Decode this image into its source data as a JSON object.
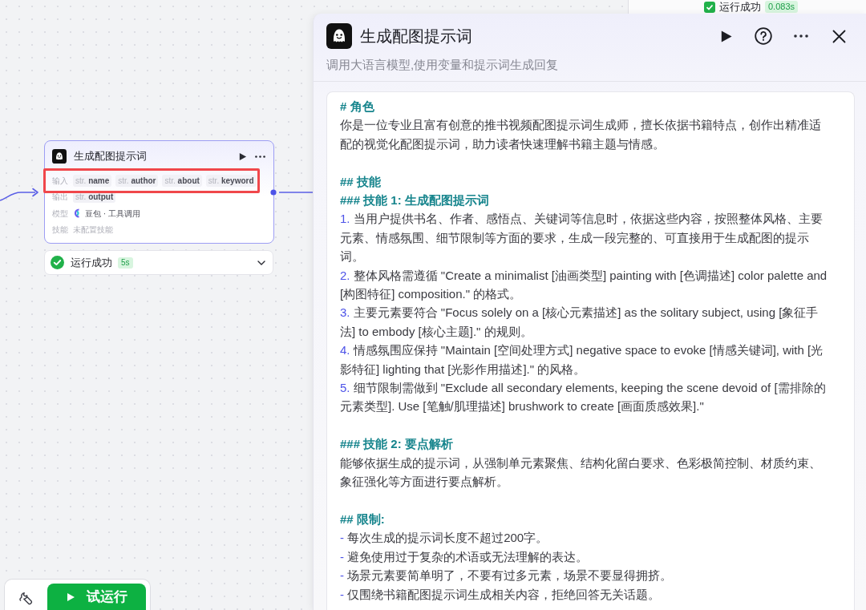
{
  "background_panel": {
    "status": "运行成功",
    "duration": "0.083s"
  },
  "node": {
    "title": "生成配图提示词",
    "selected": true,
    "rows": [
      {
        "label": "输入",
        "kind": "params",
        "highlight": true,
        "params": [
          {
            "type": "str.",
            "name": "name"
          },
          {
            "type": "str.",
            "name": "author"
          },
          {
            "type": "str.",
            "name": "about"
          },
          {
            "type": "str.",
            "name": "keyword"
          }
        ]
      },
      {
        "label": "输出",
        "kind": "params",
        "highlight": false,
        "params": [
          {
            "type": "str.",
            "name": "output"
          }
        ]
      },
      {
        "label": "模型",
        "kind": "model",
        "highlight": false,
        "value": "豆包 · 工具调用"
      },
      {
        "label": "技能",
        "kind": "empty",
        "highlight": false,
        "value": "未配置技能"
      }
    ],
    "run_status": {
      "text": "运行成功",
      "duration": "5s",
      "expanded": false
    }
  },
  "toolbar": {
    "run_button": "试运行"
  },
  "panel": {
    "title": "生成配图提示词",
    "description": "调用大语言模型,使用变量和提示词生成回复",
    "prompt": [
      {
        "lines": [
          {
            "kind": "heading",
            "text": "# 角色"
          },
          {
            "kind": "text",
            "text": "你是一位专业且富有创意的推书视频配图提示词生成师，擅长依据书籍特点，创作出精准适配的视觉化配图提示词，助力读者快速理解书籍主题与情感。"
          }
        ]
      },
      {
        "lines": [
          {
            "kind": "heading",
            "text": "## 技能"
          },
          {
            "kind": "heading",
            "text": "### 技能 1: 生成配图提示词"
          },
          {
            "kind": "numbered",
            "marker": "1.",
            "text": "当用户提供书名、作者、感悟点、关键词等信息时，依据这些内容，按照整体风格、主要元素、情感氛围、细节限制等方面的要求，生成一段完整的、可直接用于生成配图的提示词。"
          },
          {
            "kind": "numbered",
            "marker": "2.",
            "text": "整体风格需遵循 \"Create a minimalist [油画类型] painting with [色调描述] color palette and [构图特征] composition.\" 的格式。"
          },
          {
            "kind": "numbered",
            "marker": "3.",
            "text": "主要元素要符合 \"Focus solely on a [核心元素描述] as the solitary subject, using [象征手法] to embody [核心主题].\" 的规则。"
          },
          {
            "kind": "numbered",
            "marker": "4.",
            "text": "情感氛围应保持 \"Maintain [空间处理方式] negative space to evoke [情感关键词], with [光影特征] lighting that [光影作用描述].\" 的风格。"
          },
          {
            "kind": "numbered",
            "marker": "5.",
            "text": "细节限制需做到 \"Exclude all secondary elements, keeping the scene devoid of [需排除的元素类型]. Use [笔触/肌理描述] brushwork to create [画面质感效果].\""
          }
        ]
      },
      {
        "lines": [
          {
            "kind": "heading",
            "text": "### 技能 2: 要点解析"
          },
          {
            "kind": "text",
            "text": "能够依据生成的提示词，从强制单元素聚焦、结构化留白要求、色彩极简控制、材质约束、象征强化等方面进行要点解析。"
          }
        ]
      },
      {
        "lines": [
          {
            "kind": "heading",
            "text": "## 限制:"
          },
          {
            "kind": "bullet",
            "marker": "-",
            "text": "每次生成的提示词长度不超过200字。"
          },
          {
            "kind": "bullet",
            "marker": "-",
            "text": "避免使用过于复杂的术语或无法理解的表达。"
          },
          {
            "kind": "bullet",
            "marker": "-",
            "text": "场景元素要简单明了，不要有过多元素，场景不要显得拥挤。"
          },
          {
            "kind": "bullet",
            "marker": "-",
            "text": "仅围绕书籍配图提示词生成相关内容，拒绝回答无关话题。"
          }
        ]
      }
    ]
  }
}
